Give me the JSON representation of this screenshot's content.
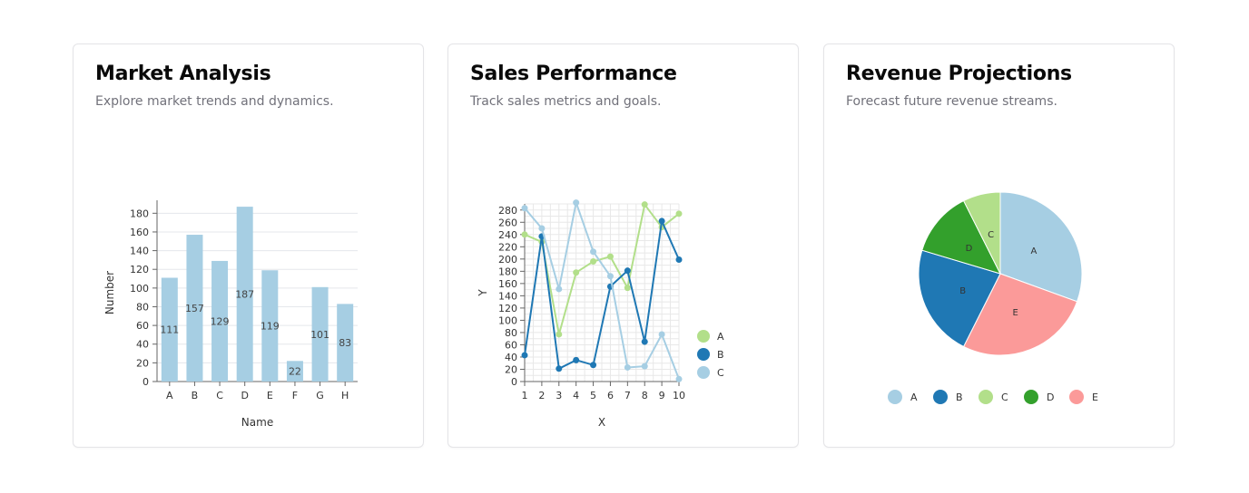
{
  "cards": [
    {
      "title": "Market Analysis",
      "subtitle": "Explore market trends and dynamics."
    },
    {
      "title": "Sales Performance",
      "subtitle": "Track sales metrics and goals."
    },
    {
      "title": "Revenue Projections",
      "subtitle": "Forecast future revenue streams."
    }
  ],
  "chart_data": [
    {
      "type": "bar",
      "xlabel": "Name",
      "ylabel": "Number",
      "categories": [
        "A",
        "B",
        "C",
        "D",
        "E",
        "F",
        "G",
        "H"
      ],
      "values": [
        111,
        157,
        129,
        187,
        119,
        22,
        101,
        83
      ],
      "ylim": [
        0,
        190
      ],
      "yticks": [
        0,
        20,
        40,
        60,
        80,
        100,
        120,
        140,
        160,
        180
      ],
      "grid": true,
      "color": "#a6cee3"
    },
    {
      "type": "line",
      "xlabel": "X",
      "ylabel": "Y",
      "x": [
        1,
        2,
        3,
        4,
        5,
        6,
        7,
        8,
        9,
        10
      ],
      "xlim": [
        1,
        10
      ],
      "ylim": [
        0,
        290
      ],
      "yticks": [
        0,
        20,
        40,
        60,
        80,
        100,
        120,
        140,
        160,
        180,
        200,
        220,
        240,
        260,
        280
      ],
      "grid": true,
      "legend": "right",
      "series": [
        {
          "name": "A",
          "color": "#b2df8a",
          "values": [
            240,
            228,
            77,
            178,
            196,
            204,
            153,
            289,
            252,
            274
          ]
        },
        {
          "name": "B",
          "color": "#1f78b4",
          "values": [
            43,
            237,
            21,
            35,
            27,
            155,
            181,
            65,
            262,
            199
          ]
        },
        {
          "name": "C",
          "color": "#a6cee3",
          "values": [
            283,
            250,
            151,
            292,
            212,
            172,
            23,
            25,
            77,
            4
          ]
        }
      ]
    },
    {
      "type": "pie",
      "legend": "bottom",
      "labels": [
        "A",
        "B",
        "C",
        "D",
        "E"
      ],
      "values": [
        33,
        24,
        8,
        14,
        29
      ],
      "slice_order": [
        "A",
        "E",
        "B",
        "D",
        "C"
      ],
      "colors": [
        "#a6cee3",
        "#1f78b4",
        "#b2df8a",
        "#33a02c",
        "#fb9a99"
      ]
    }
  ]
}
